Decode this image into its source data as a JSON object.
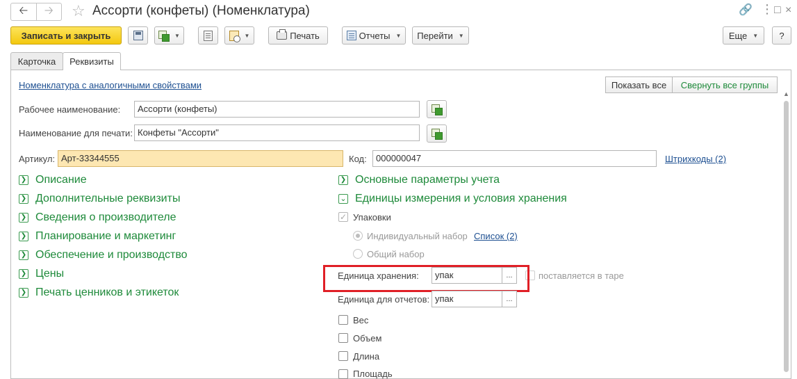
{
  "window": {
    "title": "Ассорти (конфеты) (Номенклатура)"
  },
  "toolbar": {
    "save_close": "Записать и закрыть",
    "print": "Печать",
    "reports": "Отчеты",
    "goto": "Перейти",
    "more": "Еще",
    "help": "?"
  },
  "tabs": [
    {
      "label": "Карточка",
      "active": false
    },
    {
      "label": "Реквизиты",
      "active": true
    }
  ],
  "links": {
    "similar": "Номенклатура с аналогичными свойствами",
    "barcodes": "Штрихкоды (2)",
    "list": "Список (2)"
  },
  "group_buttons": {
    "show_all": "Показать все",
    "collapse_all": "Свернуть все группы"
  },
  "fields": {
    "work_name": {
      "label": "Рабочее наименование:",
      "value": "Ассорти (конфеты)"
    },
    "print_name": {
      "label": "Наименование для печати:",
      "value": "Конфеты \"Ассорти\""
    },
    "article": {
      "label": "Артикул:",
      "value": "Арт-33344555"
    },
    "code": {
      "label": "Код:",
      "value": "000000047"
    },
    "storage_unit": {
      "label": "Единица хранения:",
      "value": "упак"
    },
    "report_unit": {
      "label": "Единица для отчетов:",
      "value": "упак"
    }
  },
  "groups_left": [
    {
      "label": "Описание",
      "expanded": false
    },
    {
      "label": "Дополнительные реквизиты",
      "expanded": false
    },
    {
      "label": "Сведения о производителе",
      "expanded": false
    },
    {
      "label": "Планирование и маркетинг",
      "expanded": false
    },
    {
      "label": "Обеспечение и производство",
      "expanded": false
    },
    {
      "label": "Цены",
      "expanded": false
    },
    {
      "label": "Печать ценников и этикеток",
      "expanded": false
    }
  ],
  "groups_right": [
    {
      "label": "Основные параметры учета",
      "expanded": false
    },
    {
      "label": "Единицы измерения и условия хранения",
      "expanded": true
    }
  ],
  "packaging": {
    "label": "Упаковки",
    "checked": true,
    "options": [
      {
        "label": "Индивидуальный набор",
        "selected": true
      },
      {
        "label": "Общий набор",
        "selected": false
      }
    ],
    "in_container": "поставляется в таре"
  },
  "checkboxes": [
    {
      "label": "Вес",
      "checked": false
    },
    {
      "label": "Объем",
      "checked": false
    },
    {
      "label": "Длина",
      "checked": false
    },
    {
      "label": "Площадь",
      "checked": false
    }
  ],
  "colors": {
    "accent_yellow": "#f3c80f",
    "group_green": "#1e8a3a",
    "link_blue": "#1d4f91",
    "highlight_red": "#e01f26"
  }
}
